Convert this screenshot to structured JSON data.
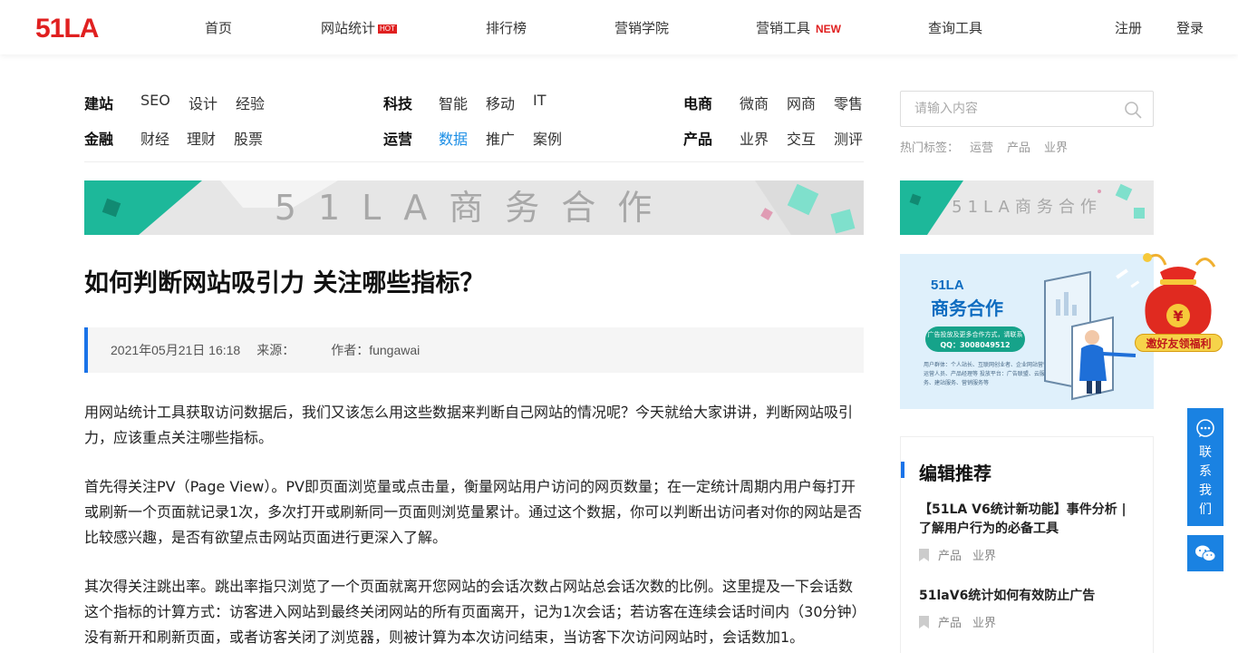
{
  "header": {
    "logo": "51LA",
    "nav": [
      {
        "label": "首页"
      },
      {
        "label": "网站统计",
        "badge": "HOT"
      },
      {
        "label": "排行榜"
      },
      {
        "label": "营销学院"
      },
      {
        "label": "营销工具",
        "badge": "NEW"
      },
      {
        "label": "查询工具"
      }
    ],
    "register": "注册",
    "login": "登录"
  },
  "categories": [
    {
      "head": "建站",
      "links": [
        "SEO",
        "设计",
        "经验"
      ]
    },
    {
      "head": "科技",
      "links": [
        "智能",
        "移动",
        "IT"
      ]
    },
    {
      "head": "电商",
      "links": [
        "微商",
        "网商",
        "零售"
      ]
    },
    {
      "head": "金融",
      "links": [
        "财经",
        "理财",
        "股票"
      ]
    },
    {
      "head": "运营",
      "links": [
        "数据",
        "推广",
        "案例"
      ],
      "active": "数据"
    },
    {
      "head": "产品",
      "links": [
        "业界",
        "交互",
        "测评"
      ]
    }
  ],
  "search": {
    "placeholder": "请输入内容",
    "hot_label": "热门标签：",
    "hot_tags": [
      "运营",
      "产品",
      "业界"
    ]
  },
  "banners": {
    "wide_text": "51LA商务合作",
    "side_text": "51LA商务合作",
    "ad_title1": "51LA",
    "ad_title2": "商务合作",
    "ad_pill_line1": "广告投放及更多合作方式，请联系",
    "ad_pill_line2": "QQ：3008049512",
    "ad_small": "用户群体：个人站长、互联网创业者、企业网站营销运营人员、产品经理等 投放平台：广告联盟、云服务、建站服务、营销服务等",
    "promo_label": "邀好友领福利"
  },
  "article": {
    "title": "如何判断网站吸引力 关注哪些指标？",
    "date": "2021年05月21日 16:18",
    "source_label": "来源：",
    "author_label": "作者：fungawai",
    "paragraphs": [
      "用网站统计工具获取访问数据后，我们又该怎么用这些数据来判断自己网站的情况呢？今天就给大家讲讲，判断网站吸引力，应该重点关注哪些指标。",
      "首先得关注PV（Page View）。PV即页面浏览量或点击量，衡量网站用户访问的网页数量；在一定统计周期内用户每打开或刷新一个页面就记录1次，多次打开或刷新同一页面则浏览量累计。通过这个数据，你可以判断出访问者对你的网站是否比较感兴趣，是否有欲望点击网站页面进行更深入了解。",
      "其次得关注跳出率。跳出率指只浏览了一个页面就离开您网站的会话次数占网站总会话次数的比例。这里提及一下会话数这个指标的计算方式：访客进入网站到最终关闭网站的所有页面离开，记为1次会话；若访客在连续会话时间内（30分钟）没有新开和刷新页面，或者访客关闭了浏览器，则被计算为本次访问结束，当访客下次访问网站时，会话数加1。"
    ]
  },
  "recommend": {
    "title": "编辑推荐",
    "items": [
      {
        "title": "【51LA V6统计新功能】事件分析 | 了解用户行为的必备工具",
        "tags": [
          "产品",
          "业界"
        ]
      },
      {
        "title": "51laV6统计如何有效防止广告",
        "tags": [
          "产品",
          "业界"
        ]
      }
    ]
  },
  "float": {
    "contact": [
      "联",
      "系",
      "我",
      "们"
    ]
  },
  "colors": {
    "accent": "#1a73e8",
    "active_link": "#1a8ee6",
    "logo_red": "#e02020",
    "float_blue": "#1a82e2"
  }
}
